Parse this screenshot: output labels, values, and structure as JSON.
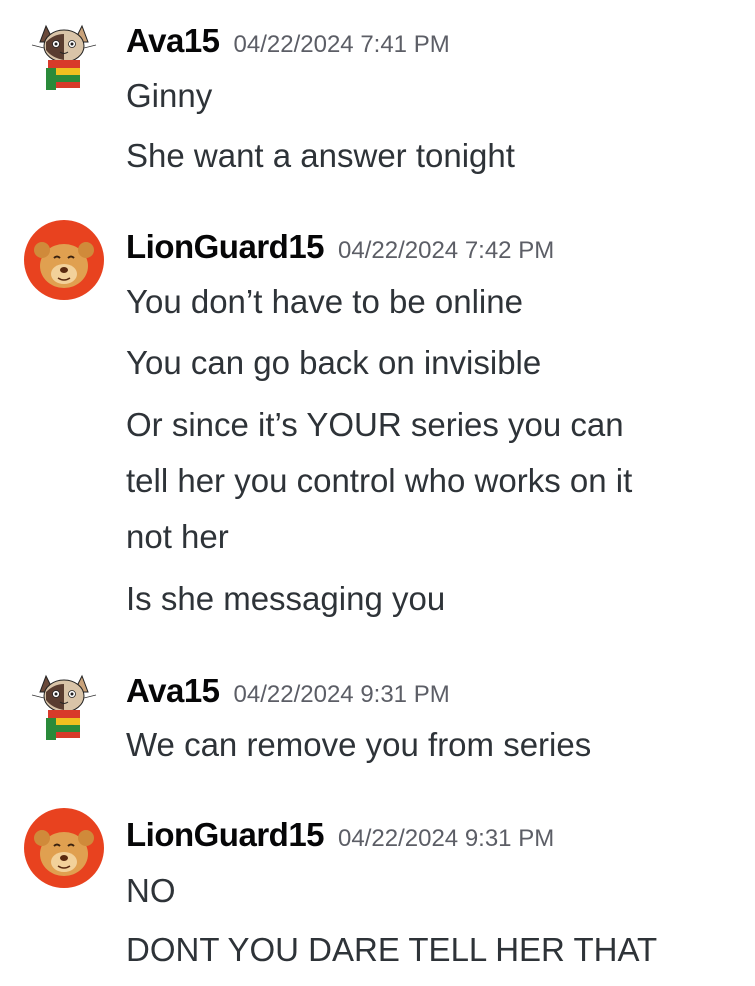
{
  "messages": [
    {
      "username": "Ava15",
      "timestamp": "04/22/2024 7:41 PM",
      "avatar": "cat-avatar-icon",
      "lines": [
        "Ginny",
        "She want a answer tonight"
      ]
    },
    {
      "username": "LionGuard15",
      "timestamp": "04/22/2024 7:42 PM",
      "avatar": "lion-avatar-icon",
      "lines": [
        "You don’t have to be online",
        "You can go back on invisible",
        "Or since it’s YOUR series you can",
        "tell her you control who works on it",
        "not her",
        "Is she messaging you"
      ]
    },
    {
      "username": "Ava15",
      "timestamp": "04/22/2024 9:31 PM",
      "avatar": "cat-avatar-icon",
      "lines": [
        "We can remove you from series"
      ]
    },
    {
      "username": "LionGuard15",
      "timestamp": "04/22/2024 9:31 PM",
      "avatar": "lion-avatar-icon",
      "lines": [
        "NO",
        "DONT YOU DARE TELL HER THAT"
      ]
    }
  ],
  "colors": {
    "username": "#060607",
    "timestamp": "#5c5e66",
    "text": "#2e3338",
    "lion_bg": "#e8421f"
  }
}
